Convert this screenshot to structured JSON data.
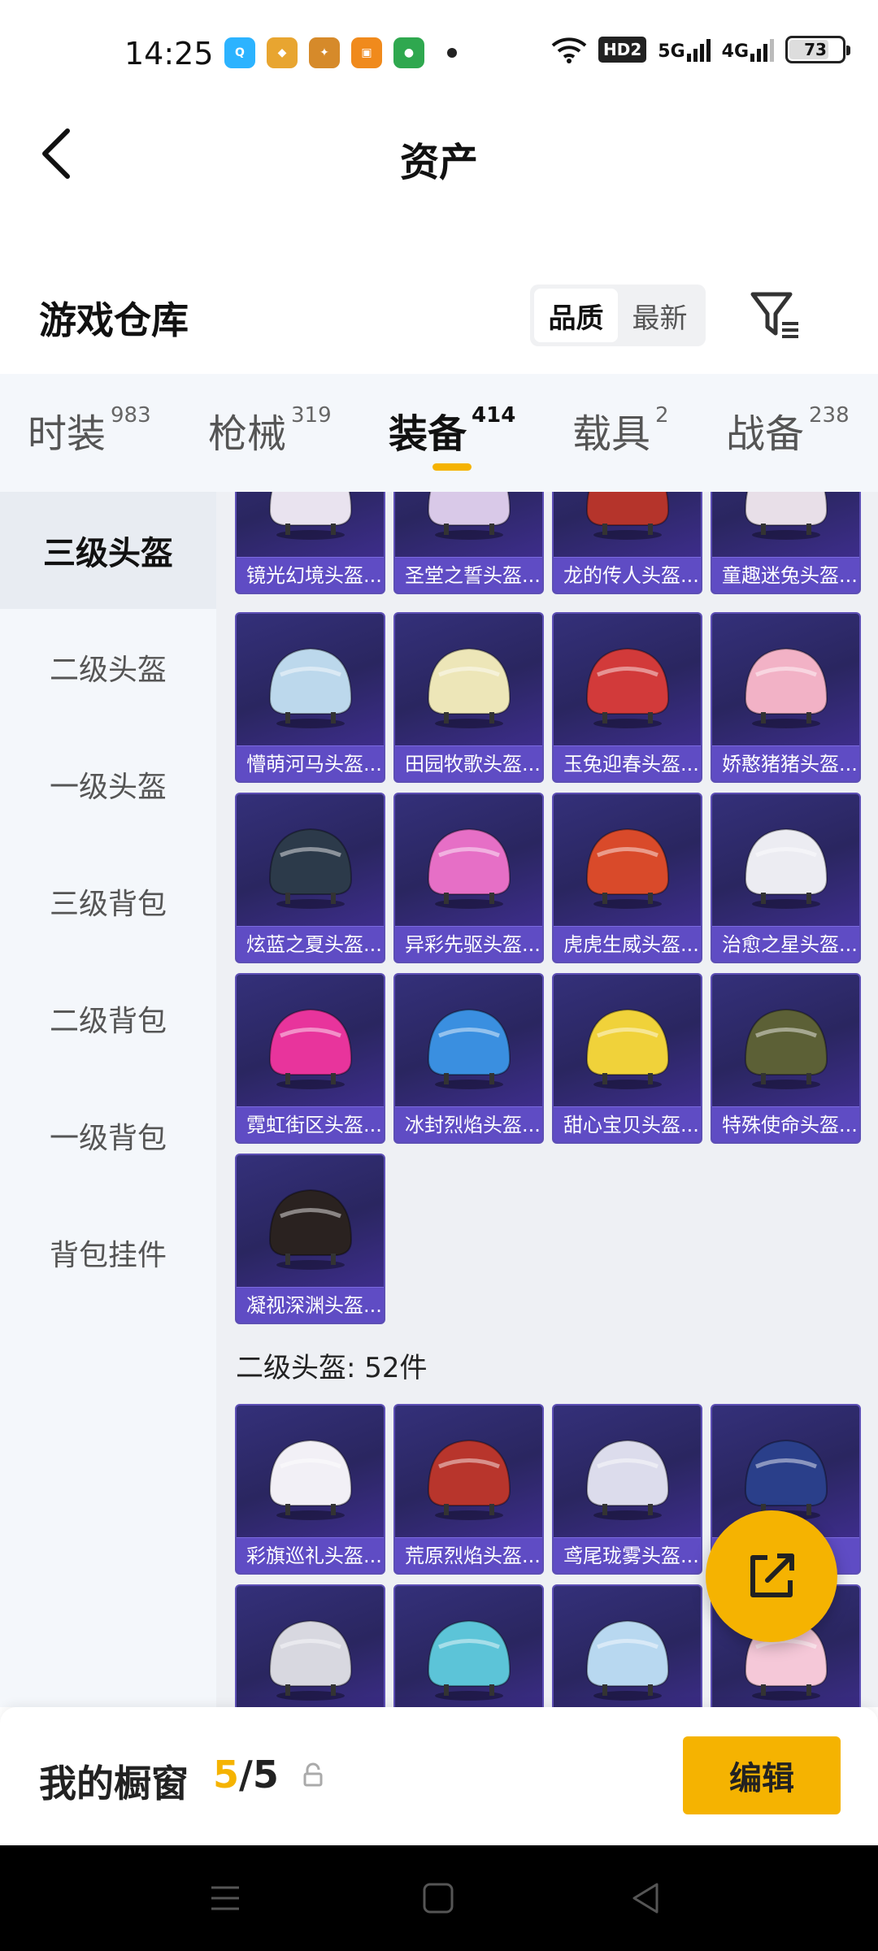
{
  "status": {
    "time": "14:25",
    "hd_label": "HD2",
    "net1": "5G",
    "net2": "4G",
    "battery": "73"
  },
  "header": {
    "title": "资产"
  },
  "warehouse": {
    "title": "游戏仓库",
    "sort_quality": "品质",
    "sort_newest": "最新"
  },
  "tabs": [
    {
      "label": "时装",
      "count": "983"
    },
    {
      "label": "枪械",
      "count": "319"
    },
    {
      "label": "装备",
      "count": "414"
    },
    {
      "label": "载具",
      "count": "2"
    },
    {
      "label": "战备",
      "count": "238"
    }
  ],
  "side_menu": [
    {
      "label": "三级头盔"
    },
    {
      "label": "二级头盔"
    },
    {
      "label": "一级头盔"
    },
    {
      "label": "三级背包"
    },
    {
      "label": "二级背包"
    },
    {
      "label": "一级背包"
    },
    {
      "label": "背包挂件"
    }
  ],
  "items_level3": [
    {
      "name": "镜光幻境头盔...",
      "color": "#e9e3ef"
    },
    {
      "name": "圣堂之誓头盔...",
      "color": "#d9c9e8"
    },
    {
      "name": "龙的传人头盔...",
      "color": "#b5342b"
    },
    {
      "name": "童趣迷兔头盔...",
      "color": "#e8dfe8"
    },
    {
      "name": "懵萌河马头盔...",
      "color": "#bcd8ec"
    },
    {
      "name": "田园牧歌头盔...",
      "color": "#ede6b8"
    },
    {
      "name": "玉兔迎春头盔...",
      "color": "#d23a3a"
    },
    {
      "name": "娇憨猪猪头盔...",
      "color": "#f2b2c6"
    },
    {
      "name": "炫蓝之夏头盔...",
      "color": "#2c3a4a"
    },
    {
      "name": "异彩先驱头盔...",
      "color": "#e66fc6"
    },
    {
      "name": "虎虎生威头盔...",
      "color": "#d94a2a"
    },
    {
      "name": "治愈之星头盔...",
      "color": "#ececf2"
    },
    {
      "name": "霓虹街区头盔...",
      "color": "#e8349c"
    },
    {
      "name": "冰封烈焰头盔...",
      "color": "#3a8fe0"
    },
    {
      "name": "甜心宝贝头盔...",
      "color": "#f0d23a"
    },
    {
      "name": "特殊使命头盔...",
      "color": "#5c6036"
    },
    {
      "name": "凝视深渊头盔...",
      "color": "#2a2220"
    }
  ],
  "section2_label": "二级头盔: 52件",
  "items_level2": [
    {
      "name": "彩旗巡礼头盔...",
      "color": "#f2f0f6"
    },
    {
      "name": "荒原烈焰头盔...",
      "color": "#b8352c"
    },
    {
      "name": "鸢尾珑雾头盔...",
      "color": "#dcdcec"
    },
    {
      "name": "",
      "color": "#2a3f8a"
    },
    {
      "name": "",
      "color": "#d8d8e0"
    },
    {
      "name": "",
      "color": "#5cc4d8"
    },
    {
      "name": "",
      "color": "#b8d8f0"
    },
    {
      "name": "",
      "color": "#f5c8d8"
    }
  ],
  "bottom": {
    "title": "我的橱窗",
    "current": "5",
    "total": "/5",
    "edit_label": "编辑"
  },
  "colors": {
    "accent": "#f5b301",
    "card_bg": "#2a2660",
    "card_label": "#5f4cc4"
  }
}
